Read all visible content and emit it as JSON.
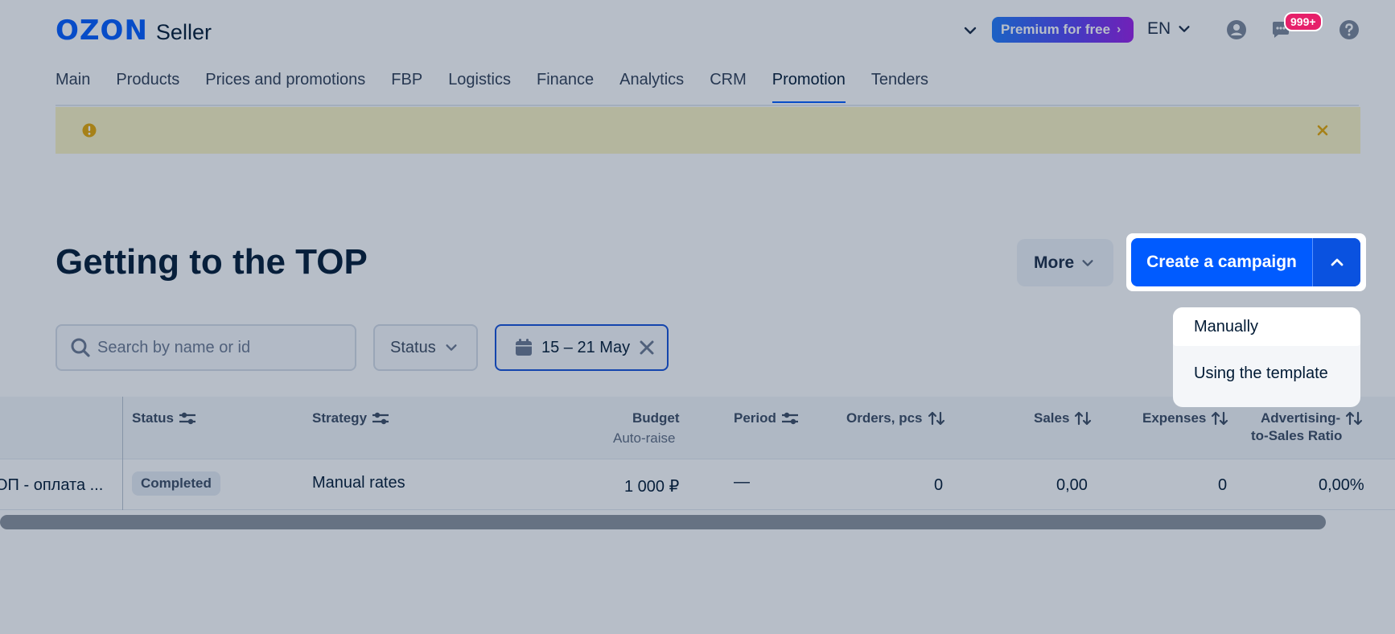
{
  "header": {
    "logo_brand": "OZON",
    "logo_product": "Seller",
    "premium_label": "Premium for free",
    "premium_chevron": "›",
    "language": "EN",
    "notification_count": "999+"
  },
  "nav": {
    "items": [
      {
        "label": "Main"
      },
      {
        "label": "Products"
      },
      {
        "label": "Prices and promotions"
      },
      {
        "label": "FBP"
      },
      {
        "label": "Logistics"
      },
      {
        "label": "Finance"
      },
      {
        "label": "Analytics"
      },
      {
        "label": "CRM"
      },
      {
        "label": "Promotion",
        "active": true
      },
      {
        "label": "Tenders"
      }
    ]
  },
  "page": {
    "title": "Getting to the TOP",
    "more_label": "More",
    "create_label": "Create a campaign"
  },
  "filters": {
    "search_placeholder": "Search by name or id",
    "status_label": "Status",
    "date_range": "15 – 21 May"
  },
  "create_menu": {
    "items": [
      "Manually",
      "Using the template"
    ]
  },
  "table": {
    "headers": {
      "status": "Status",
      "strategy": "Strategy",
      "budget": "Budget",
      "budget_sub": "Auto-raise",
      "period": "Period",
      "orders": "Orders, pcs",
      "sales": "Sales",
      "expenses": "Expenses",
      "ratio_line1": "Advertising-",
      "ratio_line2": "to-Sales Ratio"
    },
    "rows": [
      {
        "name": "ОП - оплата ...",
        "status": "Completed",
        "strategy": "Manual rates",
        "budget": "1 000 ₽",
        "period": "—",
        "orders": "0",
        "sales": "0,00",
        "expenses": "0",
        "ratio": "0,00%"
      }
    ]
  },
  "icons": {
    "chevron": "chevron-down-icon",
    "account": "account-icon",
    "chat": "chat-icon",
    "help": "help-icon",
    "alert": "warning-icon",
    "close": "close-icon",
    "search": "search-icon",
    "calendar": "calendar-icon",
    "clear": "clear-icon",
    "filter": "filter-icon",
    "sort": "sort-icon"
  },
  "colors": {
    "brand": "#005bff",
    "alert_bg": "#fbf3c2",
    "alert_icon": "#e6a700",
    "badge": "#e6206a"
  }
}
